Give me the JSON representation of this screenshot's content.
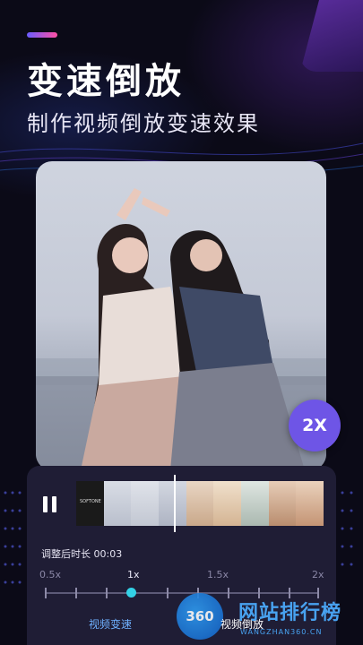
{
  "header": {
    "title": "变速倒放",
    "subtitle": "制作视频倒放变速效果"
  },
  "preview": {
    "speed_badge": "2X"
  },
  "editor": {
    "duration_text": "调整后时长 00:03",
    "speed_ticks": [
      "0.5x",
      "1x",
      "1.5x",
      "2x"
    ],
    "active_speed": "1x",
    "slider_value_fraction": 0.32,
    "thumb_caption": "SOFTONE"
  },
  "tabs": {
    "speed_tab": "视频变速",
    "reverse_tab": "视频倒放"
  },
  "watermark": {
    "badge": "360",
    "text": "网站排行榜",
    "url": "WANGZHAN360.CN"
  },
  "colors": {
    "background": "#0b0a17",
    "accent_purple": "#6e55e6",
    "slider_knob": "#33d1e6",
    "tab_active": "#6fb1ff"
  }
}
